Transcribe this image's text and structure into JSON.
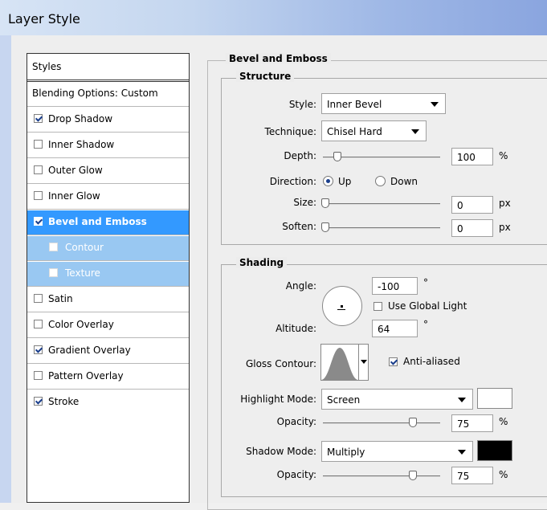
{
  "window": {
    "title": "Layer Style"
  },
  "styles_list": {
    "header": "Styles",
    "blending": "Blending Options: Custom",
    "items": [
      {
        "label": "Drop Shadow",
        "checked": true
      },
      {
        "label": "Inner Shadow",
        "checked": false
      },
      {
        "label": "Outer Glow",
        "checked": false
      },
      {
        "label": "Inner Glow",
        "checked": false
      },
      {
        "label": "Bevel and Emboss",
        "checked": true,
        "selected": true
      },
      {
        "label": "Contour",
        "checked": false,
        "sub": true
      },
      {
        "label": "Texture",
        "checked": false,
        "sub": true
      },
      {
        "label": "Satin",
        "checked": false
      },
      {
        "label": "Color Overlay",
        "checked": false
      },
      {
        "label": "Gradient Overlay",
        "checked": true
      },
      {
        "label": "Pattern Overlay",
        "checked": false
      },
      {
        "label": "Stroke",
        "checked": true
      }
    ]
  },
  "bevel": {
    "title": "Bevel and Emboss",
    "structure": {
      "title": "Structure",
      "style_label": "Style:",
      "style_value": "Inner Bevel",
      "technique_label": "Technique:",
      "technique_value": "Chisel Hard",
      "depth_label": "Depth:",
      "depth_value": "100",
      "depth_unit": "%",
      "direction_label": "Direction:",
      "direction_up": "Up",
      "direction_down": "Down",
      "direction_selected": "Up",
      "size_label": "Size:",
      "size_value": "0",
      "size_unit": "px",
      "soften_label": "Soften:",
      "soften_value": "0",
      "soften_unit": "px"
    },
    "shading": {
      "title": "Shading",
      "angle_label": "Angle:",
      "angle_value": "-100",
      "angle_unit": "°",
      "use_global_light": "Use Global Light",
      "use_global_light_checked": false,
      "altitude_label": "Altitude:",
      "altitude_value": "64",
      "altitude_unit": "°",
      "gloss_label": "Gloss Contour:",
      "anti_aliased": "Anti-aliased",
      "anti_aliased_checked": true,
      "highlight_mode_label": "Highlight Mode:",
      "highlight_mode_value": "Screen",
      "highlight_color": "#ffffff",
      "highlight_opacity_label": "Opacity:",
      "highlight_opacity_value": "75",
      "highlight_opacity_unit": "%",
      "shadow_mode_label": "Shadow Mode:",
      "shadow_mode_value": "Multiply",
      "shadow_color": "#000000",
      "shadow_opacity_label": "Opacity:",
      "shadow_opacity_value": "75",
      "shadow_opacity_unit": "%"
    }
  }
}
